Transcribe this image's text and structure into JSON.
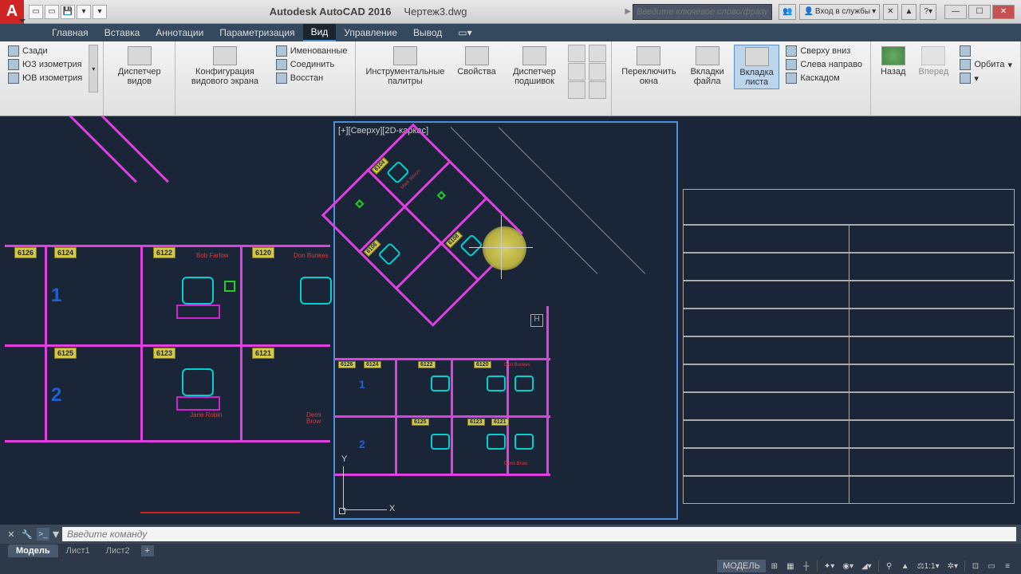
{
  "title": {
    "app": "Autodesk AutoCAD 2016",
    "file": "Чертеж3.dwg"
  },
  "search": {
    "placeholder": "Введите ключевое слово/фразу"
  },
  "signin": "Вход в службы",
  "menu": [
    "Главная",
    "Вставка",
    "Аннотации",
    "Параметризация",
    "Вид",
    "Управление",
    "Вывод"
  ],
  "menu_active": 4,
  "ribbon": {
    "views": {
      "back": "Сзади",
      "southwest": "ЮЗ изометрия",
      "southeast": "ЮВ изометрия"
    },
    "vpm": "Диспетчер видов",
    "vpc": "Конфигурация видового экрана",
    "named": "Именованные",
    "join": "Соединить",
    "restore": "Восстан",
    "tool_palettes": "Инструментальные палитры",
    "props": "Свойства",
    "ssm": "Диспетчер подшивок",
    "switch": "Переключить окна",
    "file_tabs": "Вкладки файла",
    "layout_tabs": "Вкладка листа",
    "htop": "Сверху вниз",
    "hleft": "Слева направо",
    "cascade": "Каскадом",
    "back_btn": "Назад",
    "fwd": "Вперед",
    "orbit": "Орбита"
  },
  "vp_label": "[+][Сверху][2D-каркас]",
  "rooms_left": {
    "top": [
      "6126",
      "6124",
      "6122",
      "6120"
    ],
    "bot": [
      "6125",
      "6123",
      "6121"
    ]
  },
  "rooms_mid_rot": [
    "6104",
    "6106",
    "6108"
  ],
  "rooms_mid_bot": {
    "top": [
      "6126",
      "6124",
      "6122",
      "6120"
    ],
    "bot": [
      "6125",
      "6123",
      "6121"
    ]
  },
  "names": {
    "a": "Bob Farlow",
    "b": "Don Bunkes",
    "c": "Jane Robin",
    "d": "Demi Brow",
    "e": "Mark Simon"
  },
  "cmd": {
    "placeholder": "Введите команду"
  },
  "tabs": [
    "Модель",
    "Лист1",
    "Лист2"
  ],
  "status": {
    "model": "МОДЕЛЬ",
    "scale": "1:1"
  }
}
